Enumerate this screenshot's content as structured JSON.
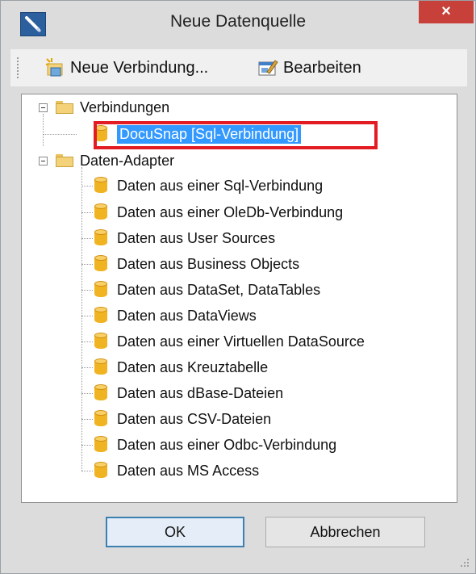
{
  "window": {
    "title": "Neue Datenquelle",
    "close_label": "×"
  },
  "toolbar": {
    "new_connection_label": "Neue Verbindung...",
    "edit_label": "Bearbeiten"
  },
  "tree": {
    "connections": {
      "label": "Verbindungen",
      "items": [
        {
          "label": "DocuSnap [Sql-Verbindung]",
          "selected": true
        }
      ]
    },
    "adapters": {
      "label": "Daten-Adapter",
      "items": [
        {
          "label": "Daten aus einer Sql-Verbindung"
        },
        {
          "label": "Daten aus einer OleDb-Verbindung"
        },
        {
          "label": "Daten aus User Sources"
        },
        {
          "label": "Daten aus Business Objects"
        },
        {
          "label": "Daten aus DataSet, DataTables"
        },
        {
          "label": "Daten aus DataViews"
        },
        {
          "label": "Daten aus einer Virtuellen DataSource"
        },
        {
          "label": "Daten aus Kreuztabelle"
        },
        {
          "label": "Daten aus dBase-Dateien"
        },
        {
          "label": "Daten aus CSV-Dateien"
        },
        {
          "label": "Daten aus einer Odbc-Verbindung"
        },
        {
          "label": "Daten aus MS Access"
        }
      ]
    }
  },
  "buttons": {
    "ok_label": "OK",
    "cancel_label": "Abbrechen"
  },
  "colors": {
    "selection": "#3399ff",
    "highlight_border": "#e31b23",
    "close_button": "#c7413a"
  }
}
